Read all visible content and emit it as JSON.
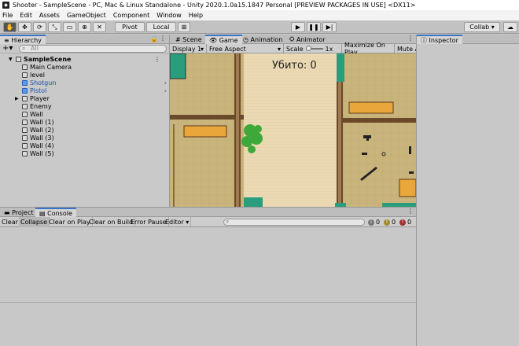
{
  "window": {
    "title": "Shooter - SampleScene - PC, Mac & Linux Standalone - Unity 2020.1.0a15.1847 Personal [PREVIEW PACKAGES IN USE] <DX11>"
  },
  "menu": [
    "File",
    "Edit",
    "Assets",
    "GameObject",
    "Component",
    "Window",
    "Help"
  ],
  "toolbar": {
    "pivot": "Pivot",
    "local": "Local",
    "collab": "Collab ▾"
  },
  "hierarchy": {
    "tab": "Hierarchy",
    "search_placeholder": "All",
    "items": [
      {
        "label": "SampleScene",
        "bold": true,
        "indent": 0,
        "arrow": "▼"
      },
      {
        "label": "Main Camera",
        "indent": 1
      },
      {
        "label": "level",
        "indent": 1
      },
      {
        "label": "Shotgun",
        "indent": 1,
        "blue": true
      },
      {
        "label": "Pistol",
        "indent": 1,
        "blue": true
      },
      {
        "label": "Player",
        "indent": 1,
        "arrow": "▶"
      },
      {
        "label": "Enemy",
        "indent": 1
      },
      {
        "label": "Wall",
        "indent": 1
      },
      {
        "label": "Wall (1)",
        "indent": 1
      },
      {
        "label": "Wall (2)",
        "indent": 1
      },
      {
        "label": "Wall (3)",
        "indent": 1
      },
      {
        "label": "Wall (4)",
        "indent": 1
      },
      {
        "label": "Wall (5)",
        "indent": 1
      }
    ]
  },
  "scene_tabs": {
    "scene": "Scene",
    "game": "Game",
    "animation": "Animation",
    "animator": "Animator"
  },
  "gamebar": {
    "display": "Display 1",
    "aspect": "Free Aspect",
    "scale": "Scale",
    "scale_value": "1x",
    "maximize": "Maximize On Play",
    "mute": "Mute A"
  },
  "game": {
    "kills_text": "Убито: 0"
  },
  "inspector": {
    "tab": "Inspector"
  },
  "console": {
    "tab_project": "Project",
    "tab_console": "Console",
    "buttons": [
      "Clear",
      "Collapse",
      "Clear on Play",
      "Clear on Build",
      "Error Pause",
      "Editor ▾"
    ],
    "counts": {
      "info": "0",
      "warn": "0",
      "error": "0"
    }
  },
  "colors": {
    "accent": "#3a72c4",
    "floor": "#c8b275"
  }
}
